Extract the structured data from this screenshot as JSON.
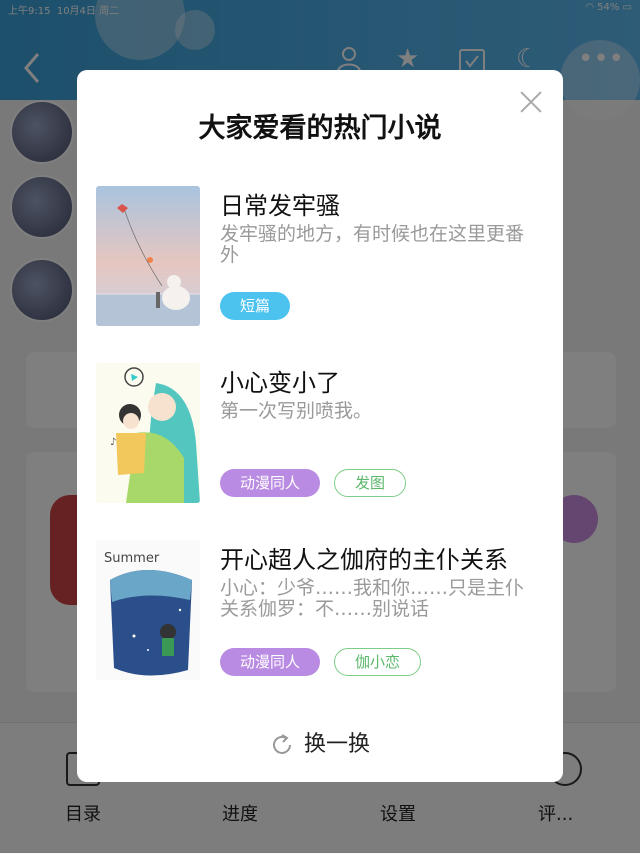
{
  "status_bar": {
    "time": "上午9:15",
    "date": "10月4日 周二",
    "battery": "54%"
  },
  "background_nav": [
    "目录",
    "进度",
    "设置",
    "评..."
  ],
  "modal": {
    "title": "大家爱看的热门小说",
    "refresh_label": "换一换",
    "books": [
      {
        "title": "日常发牢骚",
        "desc": "发牢骚的地方，有时候也在这里更番外",
        "tags": [
          {
            "label": "短篇",
            "style": "blue"
          }
        ]
      },
      {
        "title": "小心变小了",
        "desc": "第一次写别喷我。",
        "tags": [
          {
            "label": "动漫同人",
            "style": "purple"
          },
          {
            "label": "发图",
            "style": "green"
          }
        ]
      },
      {
        "title": "开心超人之伽府的主仆关系",
        "desc": "小心：少爷……我和你……只是主仆关系伽罗：不……别说话",
        "tags": [
          {
            "label": "动漫同人",
            "style": "purple"
          },
          {
            "label": "伽小恋",
            "style": "green"
          }
        ]
      }
    ],
    "cover3_text": "Summer"
  },
  "colors": {
    "header": "#3aa0d8",
    "tag_blue": "#4cc3ef",
    "tag_purple": "#b98be3",
    "tag_green": "#5bb86a"
  },
  "icons": [
    "back-icon",
    "person-icon",
    "star-icon",
    "calendar-check-icon",
    "moon-icon",
    "more-icon",
    "close-icon",
    "refresh-icon"
  ]
}
